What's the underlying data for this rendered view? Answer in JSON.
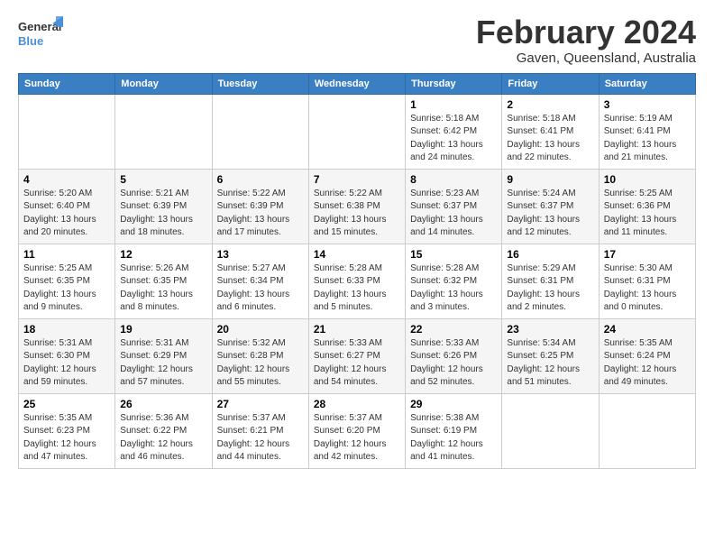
{
  "logo": {
    "line1": "General",
    "line2": "Blue"
  },
  "title": "February 2024",
  "subtitle": "Gaven, Queensland, Australia",
  "days_header": [
    "Sunday",
    "Monday",
    "Tuesday",
    "Wednesday",
    "Thursday",
    "Friday",
    "Saturday"
  ],
  "weeks": [
    [
      {
        "day": "",
        "info": ""
      },
      {
        "day": "",
        "info": ""
      },
      {
        "day": "",
        "info": ""
      },
      {
        "day": "",
        "info": ""
      },
      {
        "day": "1",
        "info": "Sunrise: 5:18 AM\nSunset: 6:42 PM\nDaylight: 13 hours\nand 24 minutes."
      },
      {
        "day": "2",
        "info": "Sunrise: 5:18 AM\nSunset: 6:41 PM\nDaylight: 13 hours\nand 22 minutes."
      },
      {
        "day": "3",
        "info": "Sunrise: 5:19 AM\nSunset: 6:41 PM\nDaylight: 13 hours\nand 21 minutes."
      }
    ],
    [
      {
        "day": "4",
        "info": "Sunrise: 5:20 AM\nSunset: 6:40 PM\nDaylight: 13 hours\nand 20 minutes."
      },
      {
        "day": "5",
        "info": "Sunrise: 5:21 AM\nSunset: 6:39 PM\nDaylight: 13 hours\nand 18 minutes."
      },
      {
        "day": "6",
        "info": "Sunrise: 5:22 AM\nSunset: 6:39 PM\nDaylight: 13 hours\nand 17 minutes."
      },
      {
        "day": "7",
        "info": "Sunrise: 5:22 AM\nSunset: 6:38 PM\nDaylight: 13 hours\nand 15 minutes."
      },
      {
        "day": "8",
        "info": "Sunrise: 5:23 AM\nSunset: 6:37 PM\nDaylight: 13 hours\nand 14 minutes."
      },
      {
        "day": "9",
        "info": "Sunrise: 5:24 AM\nSunset: 6:37 PM\nDaylight: 13 hours\nand 12 minutes."
      },
      {
        "day": "10",
        "info": "Sunrise: 5:25 AM\nSunset: 6:36 PM\nDaylight: 13 hours\nand 11 minutes."
      }
    ],
    [
      {
        "day": "11",
        "info": "Sunrise: 5:25 AM\nSunset: 6:35 PM\nDaylight: 13 hours\nand 9 minutes."
      },
      {
        "day": "12",
        "info": "Sunrise: 5:26 AM\nSunset: 6:35 PM\nDaylight: 13 hours\nand 8 minutes."
      },
      {
        "day": "13",
        "info": "Sunrise: 5:27 AM\nSunset: 6:34 PM\nDaylight: 13 hours\nand 6 minutes."
      },
      {
        "day": "14",
        "info": "Sunrise: 5:28 AM\nSunset: 6:33 PM\nDaylight: 13 hours\nand 5 minutes."
      },
      {
        "day": "15",
        "info": "Sunrise: 5:28 AM\nSunset: 6:32 PM\nDaylight: 13 hours\nand 3 minutes."
      },
      {
        "day": "16",
        "info": "Sunrise: 5:29 AM\nSunset: 6:31 PM\nDaylight: 13 hours\nand 2 minutes."
      },
      {
        "day": "17",
        "info": "Sunrise: 5:30 AM\nSunset: 6:31 PM\nDaylight: 13 hours\nand 0 minutes."
      }
    ],
    [
      {
        "day": "18",
        "info": "Sunrise: 5:31 AM\nSunset: 6:30 PM\nDaylight: 12 hours\nand 59 minutes."
      },
      {
        "day": "19",
        "info": "Sunrise: 5:31 AM\nSunset: 6:29 PM\nDaylight: 12 hours\nand 57 minutes."
      },
      {
        "day": "20",
        "info": "Sunrise: 5:32 AM\nSunset: 6:28 PM\nDaylight: 12 hours\nand 55 minutes."
      },
      {
        "day": "21",
        "info": "Sunrise: 5:33 AM\nSunset: 6:27 PM\nDaylight: 12 hours\nand 54 minutes."
      },
      {
        "day": "22",
        "info": "Sunrise: 5:33 AM\nSunset: 6:26 PM\nDaylight: 12 hours\nand 52 minutes."
      },
      {
        "day": "23",
        "info": "Sunrise: 5:34 AM\nSunset: 6:25 PM\nDaylight: 12 hours\nand 51 minutes."
      },
      {
        "day": "24",
        "info": "Sunrise: 5:35 AM\nSunset: 6:24 PM\nDaylight: 12 hours\nand 49 minutes."
      }
    ],
    [
      {
        "day": "25",
        "info": "Sunrise: 5:35 AM\nSunset: 6:23 PM\nDaylight: 12 hours\nand 47 minutes."
      },
      {
        "day": "26",
        "info": "Sunrise: 5:36 AM\nSunset: 6:22 PM\nDaylight: 12 hours\nand 46 minutes."
      },
      {
        "day": "27",
        "info": "Sunrise: 5:37 AM\nSunset: 6:21 PM\nDaylight: 12 hours\nand 44 minutes."
      },
      {
        "day": "28",
        "info": "Sunrise: 5:37 AM\nSunset: 6:20 PM\nDaylight: 12 hours\nand 42 minutes."
      },
      {
        "day": "29",
        "info": "Sunrise: 5:38 AM\nSunset: 6:19 PM\nDaylight: 12 hours\nand 41 minutes."
      },
      {
        "day": "",
        "info": ""
      },
      {
        "day": "",
        "info": ""
      }
    ]
  ]
}
